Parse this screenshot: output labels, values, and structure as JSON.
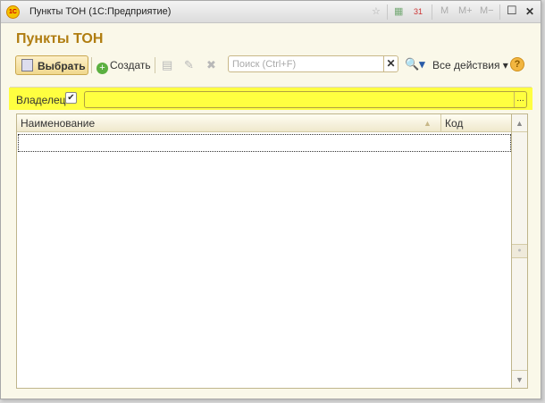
{
  "window": {
    "title": "Пункты ТОН  (1С:Предприятие)",
    "logo": "1С",
    "buttons": {
      "favorite": "☆",
      "calculator": "▦",
      "calendar": "31",
      "m": "M",
      "m_plus": "M+",
      "m_minus": "M−",
      "maximize": "☐",
      "close": "✕"
    }
  },
  "page": {
    "title": "Пункты ТОН"
  },
  "toolbar": {
    "select_label": "Выбрать",
    "create_label": "Создать",
    "search_placeholder": "Поиск (Ctrl+F)",
    "search_clear": "✕",
    "search_icon": "🔍▾",
    "all_actions_label": "Все действия ▾",
    "help": "?"
  },
  "filter": {
    "owner_label": "Владелец:",
    "owner_checked": true,
    "owner_check": "✔",
    "owner_value": "",
    "choose": "..."
  },
  "table": {
    "columns": [
      "Наименование",
      "Код"
    ],
    "rows": []
  }
}
